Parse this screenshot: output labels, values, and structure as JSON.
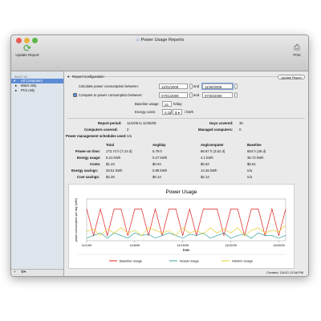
{
  "window": {
    "title": "Power Usage Reports"
  },
  "toolbar": {
    "update_label": "Update Report",
    "print_label": "Print"
  },
  "sidebar": {
    "section": "BUILT-IN",
    "items": [
      {
        "label": "All Computers"
      },
      {
        "label": "Macs only"
      },
      {
        "label": "PCs only"
      }
    ]
  },
  "config": {
    "section_label": "Report Configuration",
    "update_button": "Update Report",
    "calc_label": "Calculate power consumption between:",
    "calc_from": "11/01/2009",
    "calc_to": "11/30/2009",
    "and_label": "and",
    "compare_label": "Compare to power consumption between:",
    "compare_from": "07/01/2009",
    "compare_to": "07/30/2009",
    "baseline_label": "Baseline usage:",
    "baseline_value": "24",
    "baseline_unit": "h/day",
    "energy_label": "Energy costs:",
    "energy_value": "0.15",
    "currency": "$",
    "energy_unit": "/ kWh"
  },
  "summary": {
    "period_label": "Report period:",
    "period_value": "11/1/09 to 11/30/09",
    "days_label": "Days covered:",
    "days_value": "30",
    "covered_label": "Computers covered:",
    "covered_value": "2",
    "managed_label": "Managed computers:",
    "managed_value": "0",
    "schedules_label": "Power management schedules used:",
    "schedules_value": "n/a"
  },
  "table": {
    "headers": [
      "",
      "Total",
      "Avg/day",
      "Avg/computer",
      "Baseline"
    ],
    "rows": [
      [
        "Power-on time:",
        "173.74 h (7.24 d)",
        "5.79 h",
        "86.87 h (3.62 d)",
        "864 h (36 d)"
      ],
      [
        "Energy usage:",
        "8.21 kWh",
        "0.27 kWh",
        "4.1 kWh",
        "36.72 kWh"
      ],
      [
        "Costs:",
        "$1.23",
        "$0.04",
        "$0.62",
        "$5.51"
      ],
      [
        "Energy savings:",
        "28.51 kWh",
        "0.95 kWh",
        "14.26 kWh",
        "n/a"
      ],
      [
        "Cost savings:",
        "$4.28",
        "$0.14",
        "$2.14",
        "n/a"
      ]
    ]
  },
  "chart_data": {
    "type": "line",
    "title": "Power Usage",
    "xlabel": "Date",
    "ylabel": "power consumption per day (kWh)",
    "x_ticks": [
      "11/1/09",
      "11/8/09",
      "11/15/09",
      "11/22/09",
      "11/29/09"
    ],
    "x": [
      1,
      2,
      3,
      4,
      5,
      6,
      7,
      8,
      9,
      10,
      11,
      12,
      13,
      14,
      15,
      16,
      17,
      18,
      19,
      20,
      21,
      22,
      23,
      24,
      25,
      26,
      27,
      28,
      29,
      30
    ],
    "ylim": [
      0,
      1.6
    ],
    "series": [
      {
        "name": "Baseline Usage",
        "color": "#e02020",
        "values": [
          1.22,
          0.2,
          1.22,
          0.2,
          1.22,
          1.22,
          0.2,
          1.22,
          1.22,
          0.2,
          1.22,
          0.2,
          1.22,
          1.22,
          0.2,
          1.22,
          0.2,
          1.22,
          1.22,
          1.22,
          0.2,
          1.22,
          1.22,
          0.2,
          1.22,
          1.22,
          0.2,
          1.22,
          0.2,
          1.22
        ]
      },
      {
        "name": "Actual Usage",
        "color": "#3aa6a0",
        "values": [
          0.1,
          0.2,
          0.3,
          0.1,
          0.3,
          0.2,
          0.1,
          0.3,
          0.2,
          0.25,
          0.1,
          0.2,
          0.3,
          0.2,
          0.1,
          0.25,
          0.2,
          0.3,
          0.1,
          0.2,
          0.3,
          0.1,
          0.2,
          0.25,
          0.1,
          0.3,
          0.2,
          0.2,
          0.1,
          0.2
        ]
      },
      {
        "name": "Historic Usage",
        "color": "#e6cf33",
        "values": [
          0.35,
          0.45,
          0.2,
          0.45,
          0.3,
          0.5,
          0.3,
          0.4,
          0.2,
          0.5,
          0.4,
          0.3,
          0.4,
          0.2,
          0.5,
          0.3,
          0.4,
          0.25,
          0.5,
          0.3,
          0.45,
          0.3,
          0.5,
          0.2,
          0.4,
          0.5,
          0.3,
          0.4,
          0.35,
          0.6
        ]
      }
    ]
  },
  "status": {
    "created": "Created: 2/4/10 12:58 PM"
  }
}
